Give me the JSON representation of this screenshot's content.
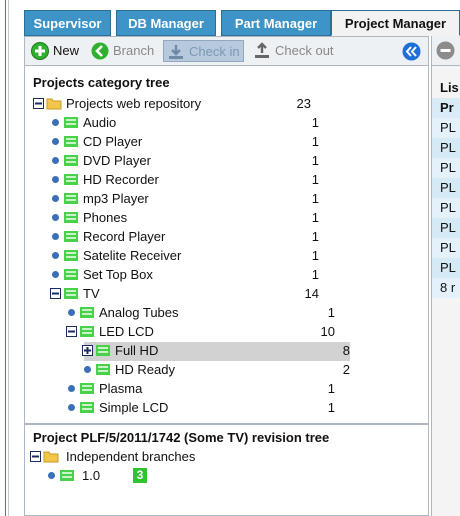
{
  "tabs": [
    {
      "label": "Supervisor",
      "active": false
    },
    {
      "label": "DB Manager",
      "active": false
    },
    {
      "label": "Part Manager",
      "active": false
    },
    {
      "label": "Project Manager",
      "active": true
    }
  ],
  "toolbar": {
    "new_label": "New",
    "branch_label": "Branch",
    "checkin_label": "Check in",
    "checkout_label": "Check out"
  },
  "category_tree": {
    "title": "Projects category tree",
    "root": {
      "label": "Projects web repository",
      "count": "23"
    },
    "items": [
      {
        "label": "Audio",
        "count": "1"
      },
      {
        "label": "CD Player",
        "count": "1"
      },
      {
        "label": "DVD Player",
        "count": "1"
      },
      {
        "label": "HD Recorder",
        "count": "1"
      },
      {
        "label": "mp3 Player",
        "count": "1"
      },
      {
        "label": "Phones",
        "count": "1"
      },
      {
        "label": "Record Player",
        "count": "1"
      },
      {
        "label": "Satelite Receiver",
        "count": "1"
      },
      {
        "label": "Set Top Box",
        "count": "1"
      },
      {
        "label": "TV",
        "count": "14"
      }
    ],
    "tv_children": [
      {
        "label": "Analog Tubes",
        "count": "1"
      },
      {
        "label": "LED LCD",
        "count": "10"
      },
      {
        "label": "Plasma",
        "count": "1"
      },
      {
        "label": "Simple LCD",
        "count": "1"
      }
    ],
    "led_children": [
      {
        "label": "Full HD",
        "count": "8",
        "selected": true
      },
      {
        "label": "HD Ready",
        "count": "2"
      }
    ]
  },
  "revision_tree": {
    "title": "Project PLF/5/2011/1742 (Some TV) revision tree",
    "root_label": "Independent branches",
    "branch": {
      "label": "1.0",
      "badge": "3"
    }
  },
  "right_panel": {
    "header": "Lis",
    "col_header": "Pr",
    "rows": [
      "PL",
      "PL",
      "PL",
      "PL",
      "PL",
      "PL",
      "PL",
      "PL"
    ],
    "footer": "8 r"
  },
  "colors": {
    "tab_bg": "#3f94c7",
    "tab_active_bg": "#f2f2f2",
    "selection": "#d2d2d2",
    "row_band": "#d9ebf7",
    "badge": "#2fc42f"
  },
  "icons": {
    "new": "plus-circle-icon",
    "branch": "branch-arrow-icon",
    "checkin": "check-in-icon",
    "checkout": "check-out-icon",
    "collapse": "collapse-arrows-icon",
    "folder": "folder-icon",
    "category": "category-green-icon",
    "bullet": "bullet-icon"
  }
}
